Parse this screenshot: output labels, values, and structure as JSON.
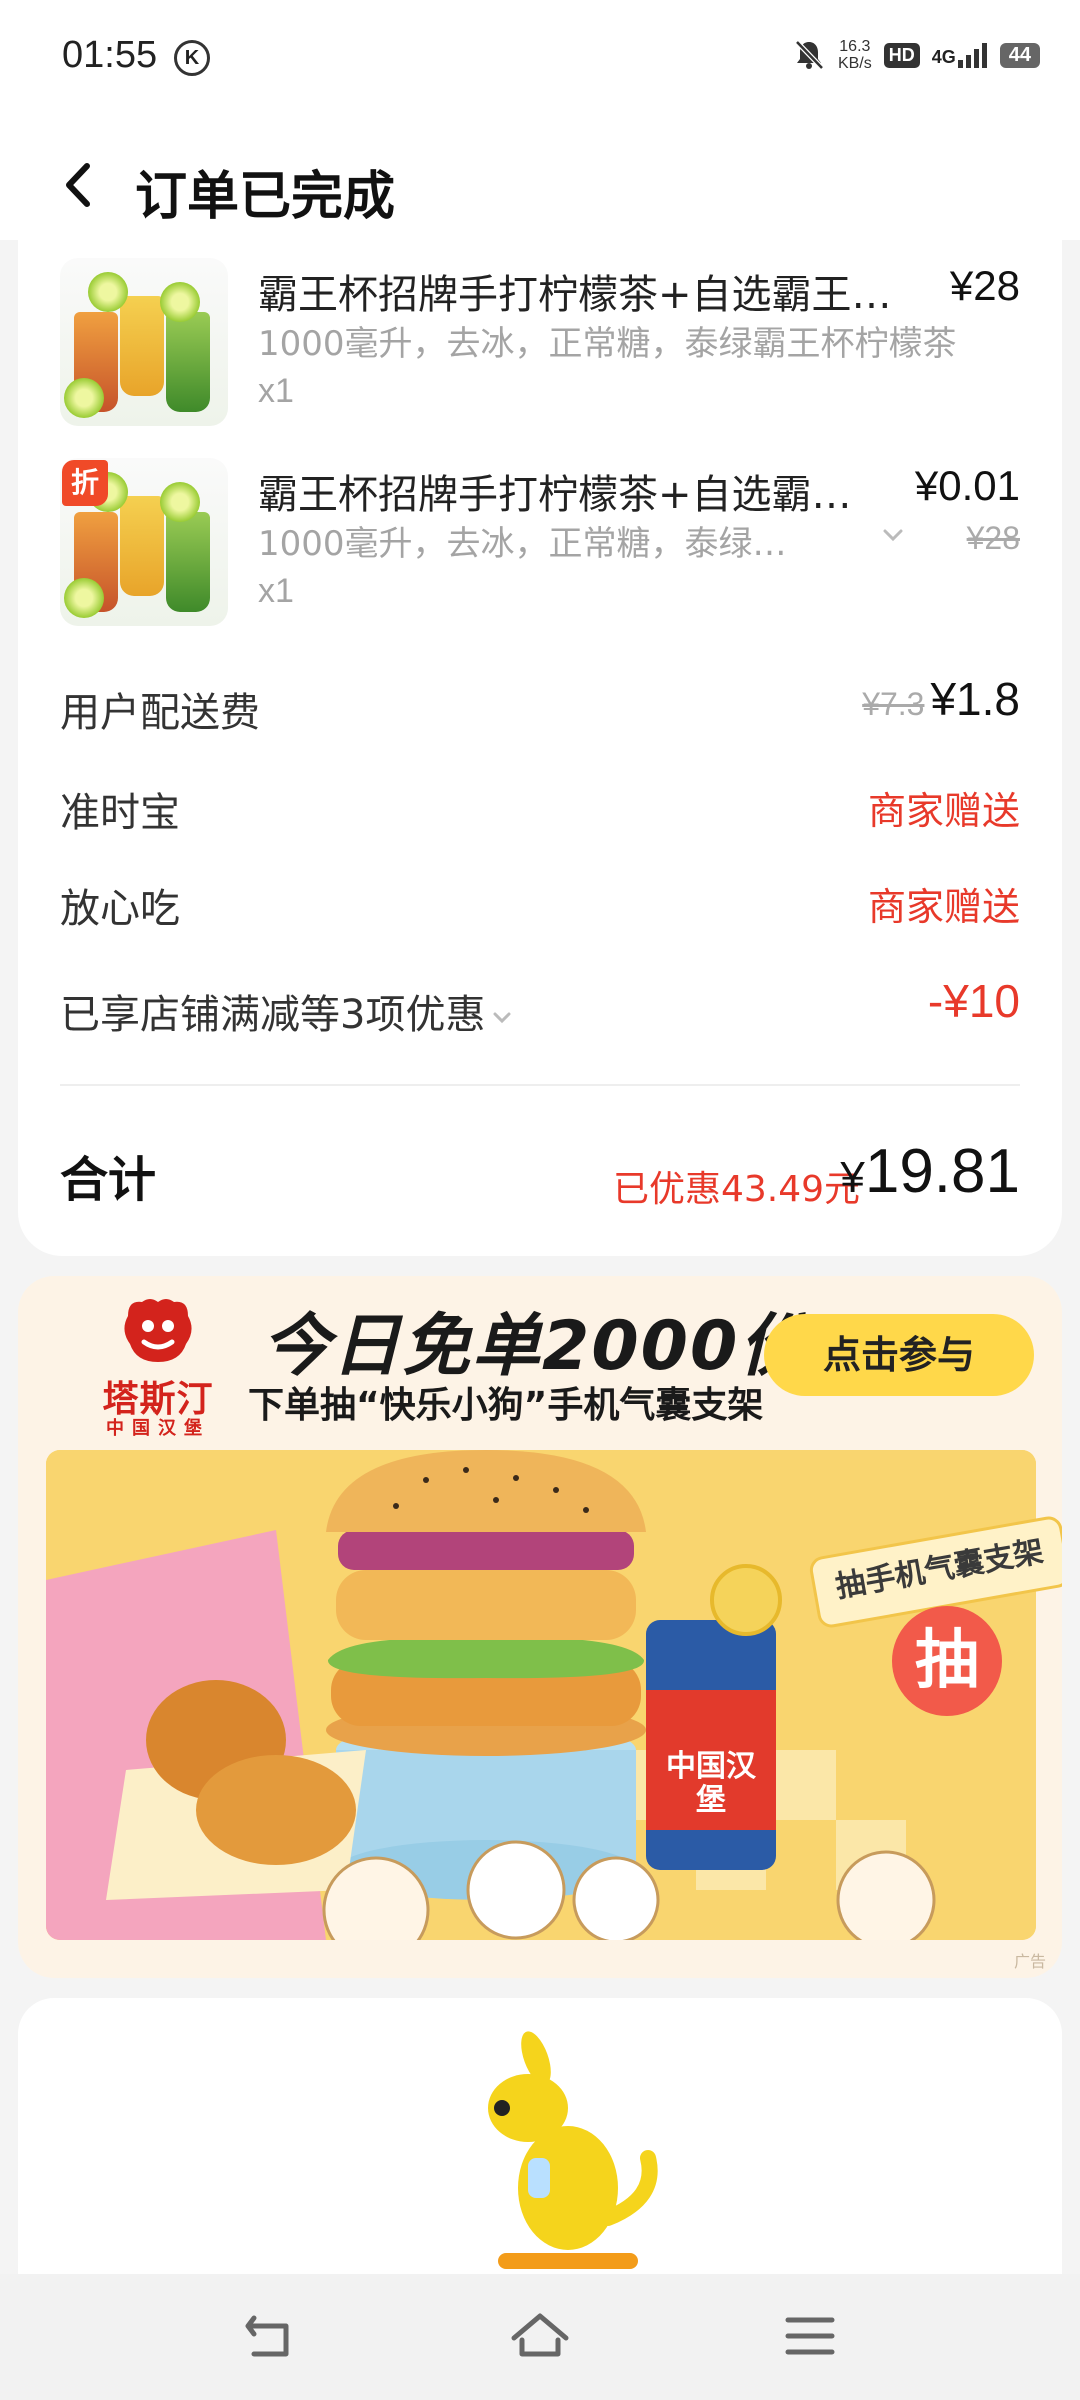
{
  "status_bar": {
    "time": "01:55",
    "k_icon": "K",
    "speed_value": "16.3",
    "speed_unit": "KB/s",
    "hd": "HD",
    "network": "4G",
    "battery": "44"
  },
  "header": {
    "title": "订单已完成"
  },
  "items": [
    {
      "name": "霸王杯招牌手打柠檬茶+自选霸王…",
      "price": "¥28",
      "spec": "1000毫升，去冰，正常糖，泰绿霸王杯柠檬茶",
      "qty": "x1"
    },
    {
      "discount_tag": "折",
      "name": "霸王杯招牌手打柠檬茶+自选霸…",
      "price": "¥0.01",
      "spec": "1000毫升，去冰，正常糖，泰绿…",
      "original_price": "¥28",
      "qty": "x1"
    }
  ],
  "fees": {
    "delivery_label": "用户配送费",
    "delivery_original": "¥7.3",
    "delivery_value": "¥1.8",
    "ontime_label": "准时宝",
    "ontime_value": "商家赠送",
    "safe_label": "放心吃",
    "safe_value": "商家赠送",
    "promo_label": "已享店铺满减等3项优惠",
    "promo_value": "-¥10"
  },
  "total": {
    "label": "合计",
    "saved": "已优惠43.49元",
    "currency": "¥",
    "amount": "19.81"
  },
  "ad": {
    "brand_name": "塔斯汀",
    "brand_sub": "中国汉堡",
    "headline": "今日免单2000份",
    "subline": "下单抽“快乐小狗”手机气囊支架",
    "cta": "点击参与",
    "badge": "抽手机气囊支架",
    "draw": "抽",
    "cup_text": "中国汉堡",
    "ad_tag": "广告"
  },
  "colors": {
    "accent_red": "#e8392a",
    "cta_yellow": "#ffd84a",
    "brand_red": "#d3231c"
  }
}
